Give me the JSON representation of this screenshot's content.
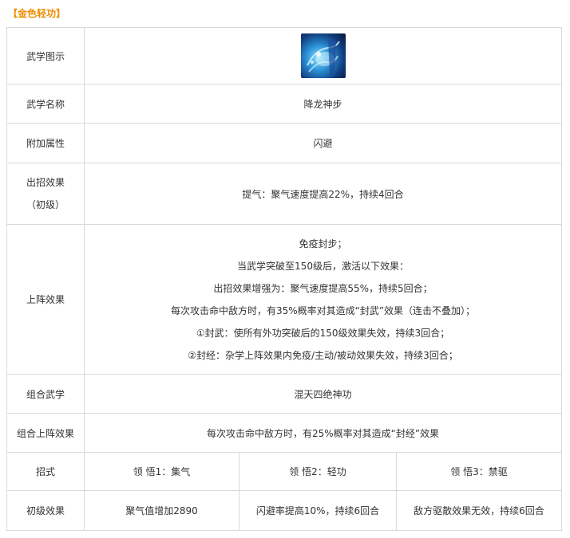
{
  "header": "【金色轻功】",
  "rows": {
    "icon_label": "武学图示",
    "name_label": "武学名称",
    "name_value": "降龙神步",
    "attr_label": "附加属性",
    "attr_value": "闪避",
    "effect_label_1": "出招效果",
    "effect_label_2": "（初级）",
    "effect_value": "提气：聚气速度提高22%，持续4回合",
    "battle_label": "上阵效果",
    "battle_lines": [
      "免疫封步；",
      "当武学突破至150级后，激活以下效果：",
      "出招效果增强为：聚气速度提高55%，持续5回合；",
      "每次攻击命中敌方时，有35%概率对其造成“封武”效果（连击不叠加）；",
      "①封武：使所有外功突破后的150级效果失效，持续3回合；",
      "②封经：杂学上阵效果内免疫/主动/被动效果失效，持续3回合；"
    ],
    "combo_label": "组合武学",
    "combo_value": "混天四绝神功",
    "combo_effect_label": "组合上阵效果",
    "combo_effect_value": "每次攻击命中敌方时，有25%概率对其造成“封经”效果",
    "move_label": "招式",
    "moves": [
      "领 悟1：集气",
      "领 悟2：轻功",
      "领 悟3：禁驱"
    ],
    "initial_label": "初级效果",
    "initials": [
      "聚气值增加2890",
      "闪避率提高10%，持续6回合",
      "敌方驱散效果无效，持续6回合"
    ]
  }
}
